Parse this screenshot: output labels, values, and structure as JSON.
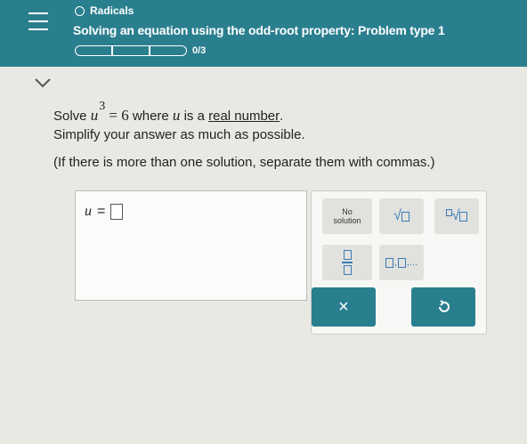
{
  "header": {
    "topic": "Radicals",
    "title": "Solving an equation using the odd-root property: Problem type 1",
    "progress_text": "0/3",
    "progress_value": 0,
    "accent_color": "#2a7f8f"
  },
  "problem": {
    "solve_word": "Solve",
    "variable": "u",
    "exponent": "3",
    "equals_rhs": "= 6",
    "where_text": "where",
    "is_a_text": "is a",
    "real_number_link": "real number",
    "period": ".",
    "simplify_line": "Simplify your answer as much as possible.",
    "hint_line": "(If there is more than one solution, separate them with commas.)"
  },
  "answer": {
    "variable": "u",
    "equals": "="
  },
  "keypad": {
    "no_solution_line1": "No",
    "no_solution_line2": "solution",
    "sqrt_icon": "square-root-icon",
    "nth_root_icon": "nth-root-icon",
    "fraction_icon": "fraction-icon",
    "list_icon": "list-icon",
    "clear_label": "×",
    "undo_icon": "undo-icon",
    "symbol_color": "#3a7bb8"
  }
}
